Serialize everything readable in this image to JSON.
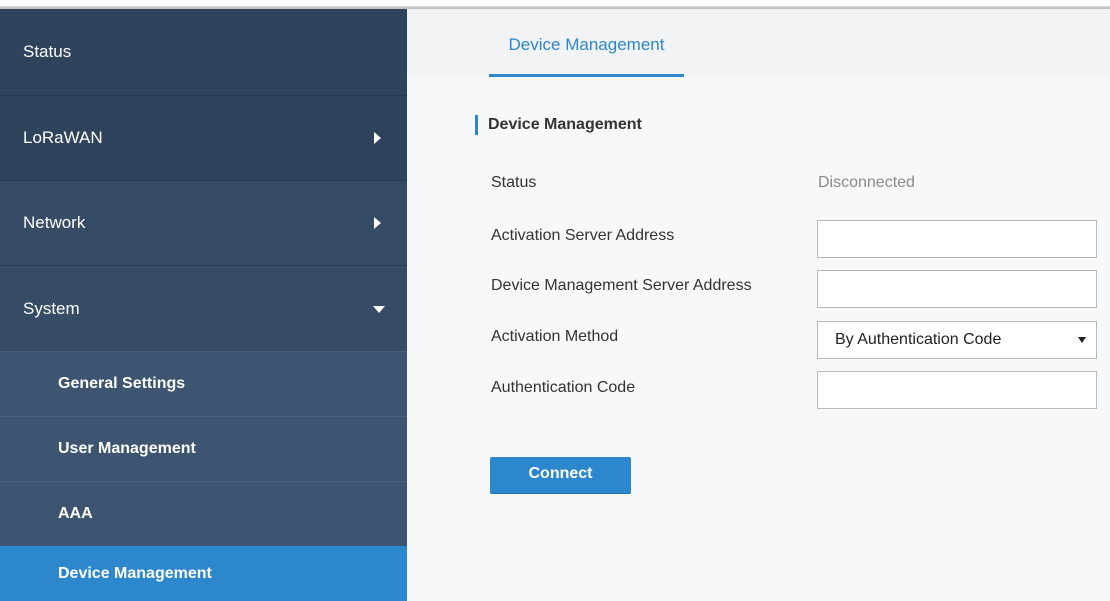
{
  "sidebar": {
    "items": [
      {
        "label": "Status"
      },
      {
        "label": "LoRaWAN"
      },
      {
        "label": "Network"
      },
      {
        "label": "System"
      }
    ],
    "system_sub": [
      {
        "label": "General Settings"
      },
      {
        "label": "User Management"
      },
      {
        "label": "AAA"
      },
      {
        "label": "Device Management"
      }
    ]
  },
  "tabs": [
    {
      "label": "Device Management"
    }
  ],
  "section": {
    "title": "Device Management"
  },
  "form": {
    "status_label": "Status",
    "status_value": "Disconnected",
    "activation_server_label": "Activation Server Address",
    "activation_server_value": "",
    "dm_server_label": "Device Management Server Address",
    "dm_server_value": "",
    "activation_method_label": "Activation Method",
    "activation_method_value": "By Authentication Code",
    "auth_code_label": "Authentication Code",
    "auth_code_value": ""
  },
  "actions": {
    "connect_label": "Connect"
  },
  "colors": {
    "accent": "#2d87cc",
    "sidebar_bg": "#364c66",
    "sidebar_dark": "#2f435c"
  }
}
